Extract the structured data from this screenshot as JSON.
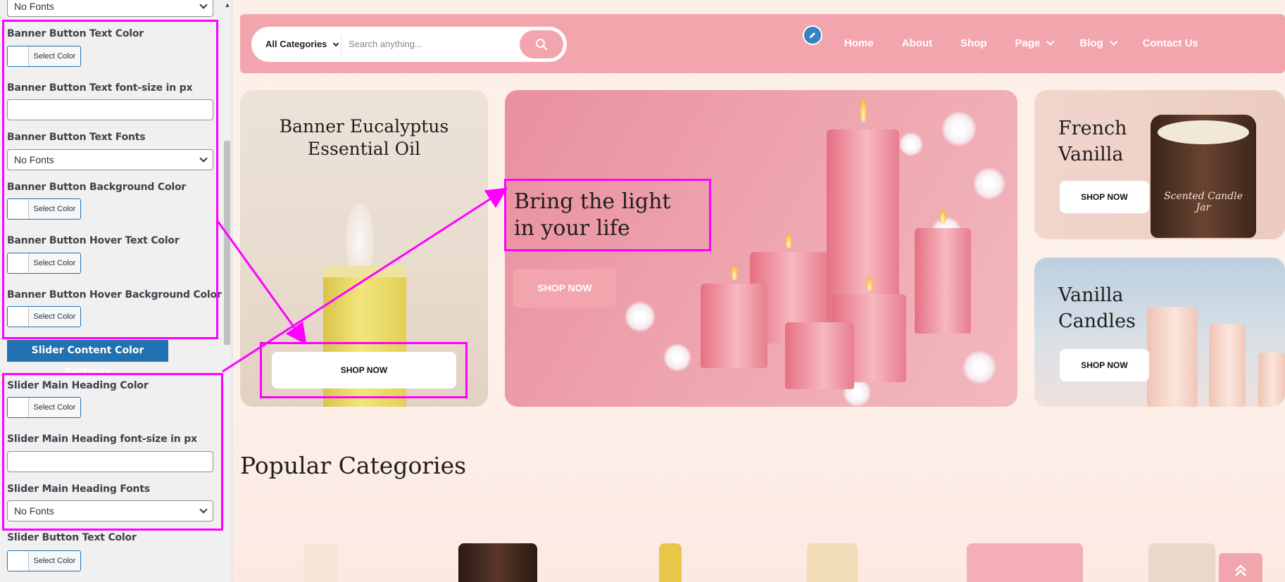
{
  "panel": {
    "top_select_value": "No Fonts",
    "controls": [
      {
        "label": "Banner Button Text Color",
        "type": "color",
        "button": "Select Color"
      },
      {
        "label": "Banner Button Text font-size in px",
        "type": "text",
        "value": ""
      },
      {
        "label": "Banner Button Text Fonts",
        "type": "select",
        "value": "No Fonts"
      },
      {
        "label": "Banner Button Background Color",
        "type": "color",
        "button": "Select Color"
      },
      {
        "label": "Banner Button Hover Text Color",
        "type": "color",
        "button": "Select Color"
      },
      {
        "label": "Banner Button Hover Background Color",
        "type": "color",
        "button": "Select Color"
      },
      {
        "label": "Slider Main Heading Color",
        "type": "color",
        "button": "Select Color"
      },
      {
        "label": "Slider Main Heading font-size in px",
        "type": "text",
        "value": ""
      },
      {
        "label": "Slider Main Heading Fonts",
        "type": "select",
        "value": "No Fonts"
      },
      {
        "label": "Slider Button Text Color",
        "type": "color",
        "button": "Select Color"
      }
    ],
    "section_button": "Slider Content Color Settings"
  },
  "header": {
    "category_select": "All Categories",
    "search_placeholder": "Search anything...",
    "nav": [
      {
        "label": "Home"
      },
      {
        "label": "About"
      },
      {
        "label": "Shop"
      },
      {
        "label": "Page"
      },
      {
        "label": "Blog"
      },
      {
        "label": "Contact Us"
      }
    ]
  },
  "banners": {
    "left": {
      "title": "Banner Eucalyptus Essential Oil",
      "button": "SHOP NOW"
    },
    "middle": {
      "title_line1": "Bring the light",
      "title_line2": "in your life",
      "button": "SHOP NOW"
    },
    "right_top": {
      "title_line1": "French",
      "title_line2": "Vanilla",
      "button": "SHOP NOW",
      "jar_label": "Scented Candle Jar"
    },
    "right_bottom": {
      "title_line1": "Vanilla",
      "title_line2": "Candles",
      "button": "SHOP NOW"
    }
  },
  "section_title": "Popular Categories",
  "colors": {
    "accent_pink": "#f3a5ad",
    "highlight": "#ff00ff",
    "wp_blue": "#2271b1"
  }
}
